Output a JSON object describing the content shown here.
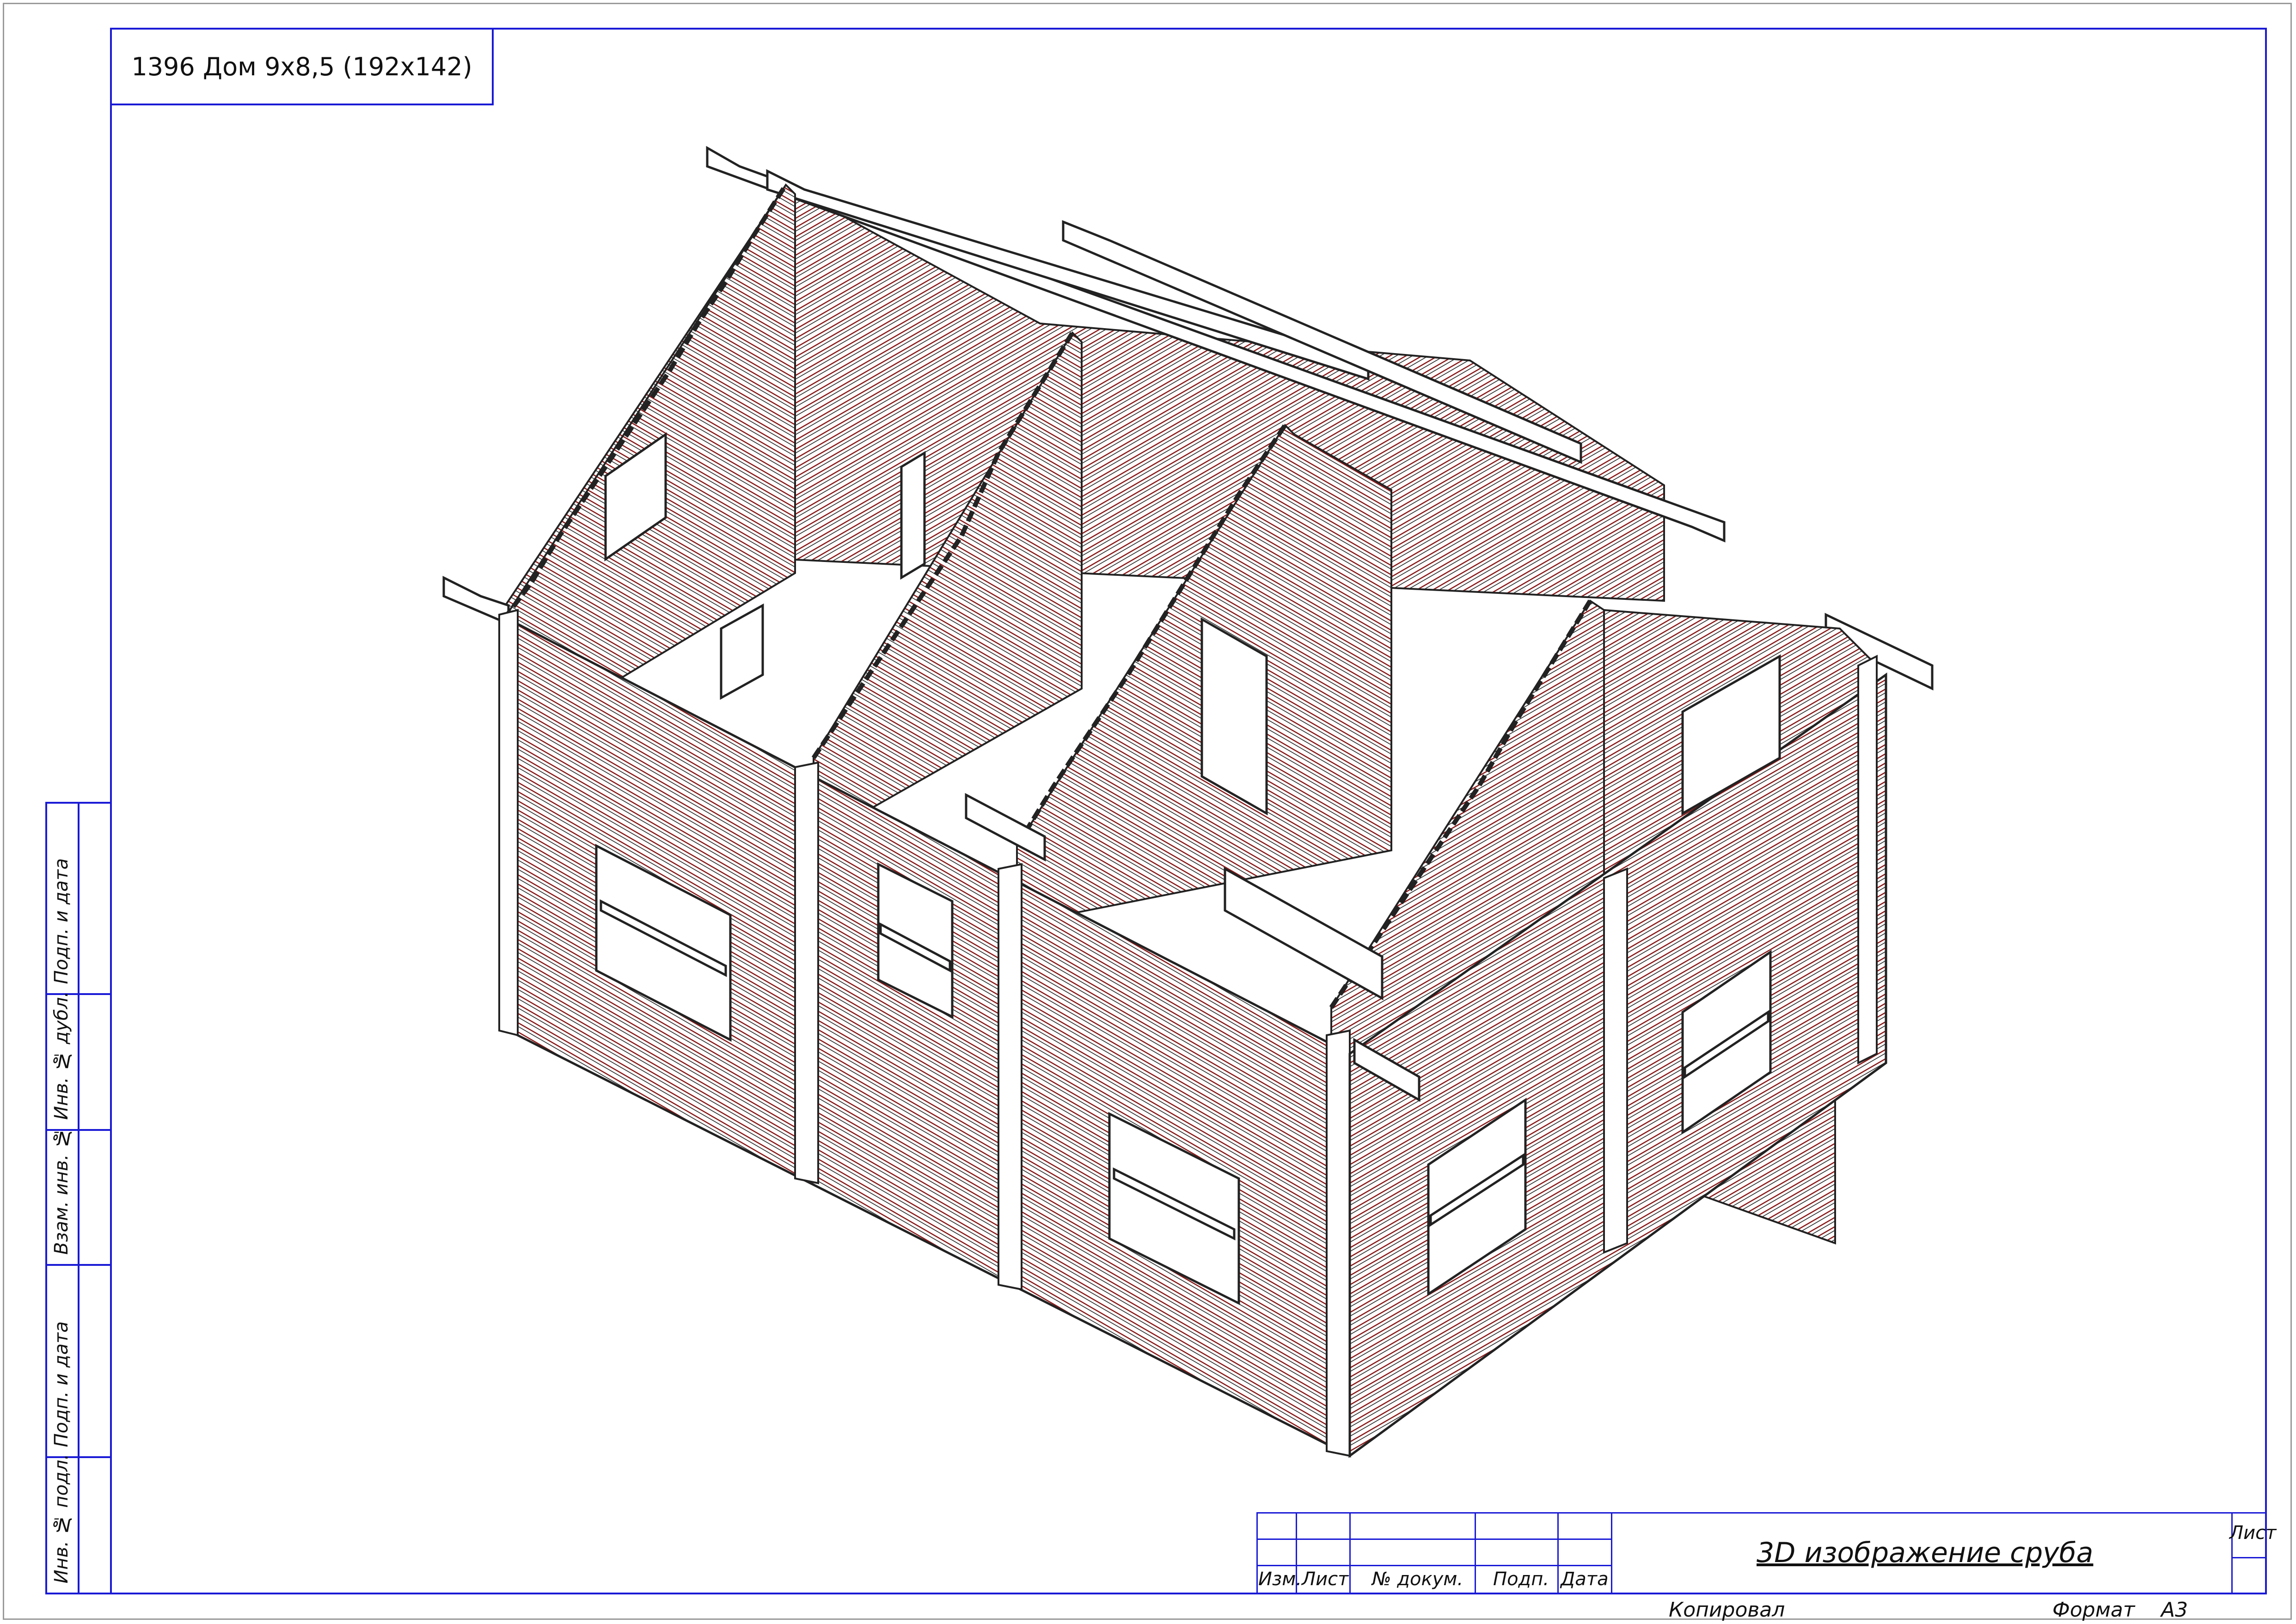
{
  "sheet": {
    "drawing_title": "1396 Дом 9х8,5 (192х142)",
    "doc_title": "3D изображение сруба",
    "colors": {
      "frame": "#1a1ad6",
      "log_lines": "#8b1a1a",
      "outline": "#222222"
    }
  },
  "side_stamp": [
    {
      "label": "Подп. и дата"
    },
    {
      "label": "Инв. № дубл."
    },
    {
      "label": "Взам. инв. №"
    },
    {
      "label": "Подп. и дата"
    },
    {
      "label": "Инв. № подл."
    }
  ],
  "title_block": {
    "columns": [
      "Изм.",
      "Лист",
      "№ докум.",
      "Подп.",
      "Дата"
    ],
    "sheet_label": "Лист"
  },
  "footer": {
    "copied": "Копировал",
    "format_label": "Формат",
    "format_value": "А3"
  }
}
